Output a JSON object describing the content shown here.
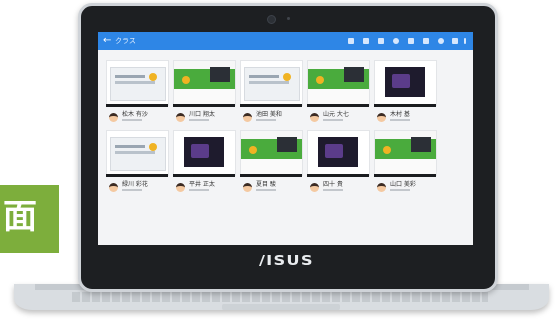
{
  "app": {
    "title": "クラス"
  },
  "toolbar": {
    "icons": [
      "grid-icon",
      "share-icon",
      "chart-icon",
      "search-icon",
      "window-icon",
      "monitor-icon",
      "settings-icon",
      "list-icon",
      "more-icon"
    ]
  },
  "tiles": [
    {
      "kind": "light"
    },
    {
      "kind": "green"
    },
    {
      "kind": "light"
    },
    {
      "kind": "green"
    },
    {
      "kind": "dark"
    },
    {
      "kind": "light"
    },
    {
      "kind": "dark"
    },
    {
      "kind": "green"
    },
    {
      "kind": "dark"
    },
    {
      "kind": "green"
    }
  ],
  "students": [
    {
      "name": "松木 有沙"
    },
    {
      "name": "川口 翔太"
    },
    {
      "name": "池田 美和"
    },
    {
      "name": "山元 大七"
    },
    {
      "name": "木村 基"
    },
    {
      "name": "緑川 彩花"
    },
    {
      "name": "平井 正太"
    },
    {
      "name": "夏目 駿"
    },
    {
      "name": "四十 貴"
    },
    {
      "name": "山口 美彩"
    }
  ],
  "brand": {
    "logo_text": "/ISUS"
  },
  "badge": {
    "char": "面"
  },
  "colors": {
    "appbar": "#2e86e6",
    "green": "#7dae3c",
    "tile_green": "#4aab3d"
  }
}
